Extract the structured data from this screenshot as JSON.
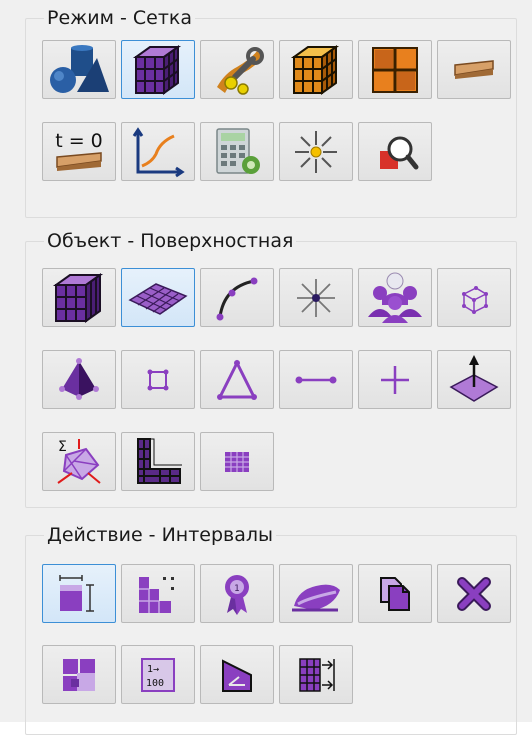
{
  "groups": {
    "mode": {
      "title": "Режим - Сетка",
      "buttons": [
        {
          "icon": "geometry-shapes-icon",
          "active": false
        },
        {
          "icon": "mesh-cube-icon",
          "active": true
        },
        {
          "icon": "tools-wrench-icon",
          "active": false
        },
        {
          "icon": "orange-mesh-cube-icon",
          "active": false
        },
        {
          "icon": "grid-frame-icon",
          "active": false
        },
        {
          "icon": "beam-bar-icon",
          "active": false
        },
        {
          "icon": "time-zero-icon",
          "label": "t = 0",
          "active": false
        },
        {
          "icon": "graph-curve-icon",
          "active": false
        },
        {
          "icon": "calculator-gear-icon",
          "active": false
        },
        {
          "icon": "sun-burst-icon",
          "active": false
        },
        {
          "icon": "zoom-inspect-icon",
          "active": false
        }
      ]
    },
    "object": {
      "title": "Объект - Поверхностная",
      "buttons": [
        {
          "icon": "volume-mesh-icon",
          "active": false
        },
        {
          "icon": "surface-mesh-icon",
          "active": true
        },
        {
          "icon": "curve-edge-icon",
          "active": false
        },
        {
          "icon": "node-star-icon",
          "active": false
        },
        {
          "icon": "group-people-icon",
          "active": false
        },
        {
          "icon": "small-cube-icon",
          "active": false
        },
        {
          "icon": "tetrahedron-icon",
          "active": false
        },
        {
          "icon": "quad-element-icon",
          "active": false
        },
        {
          "icon": "triangle-element-icon",
          "active": false
        },
        {
          "icon": "line-element-icon",
          "active": false
        },
        {
          "icon": "point-cross-icon",
          "active": false
        },
        {
          "icon": "normal-arrow-icon",
          "active": false
        },
        {
          "icon": "sum-quality-icon",
          "active": false
        },
        {
          "icon": "corner-mesh-icon",
          "active": false
        },
        {
          "icon": "small-grid-icon",
          "active": false
        }
      ]
    },
    "action": {
      "title": "Действие - Интервалы",
      "buttons": [
        {
          "icon": "interval-size-icon",
          "active": true
        },
        {
          "icon": "stair-grid-icon",
          "active": false
        },
        {
          "icon": "award-badge-icon",
          "active": false
        },
        {
          "icon": "iron-smooth-icon",
          "active": false
        },
        {
          "icon": "copy-pages-icon",
          "active": false
        },
        {
          "icon": "delete-x-icon",
          "active": false
        },
        {
          "icon": "split-block-icon",
          "active": false
        },
        {
          "icon": "number-range-icon",
          "label": "1→ 100",
          "active": false
        },
        {
          "icon": "angle-wedge-icon",
          "active": false
        },
        {
          "icon": "grid-arrows-icon",
          "active": false
        }
      ]
    }
  },
  "colors": {
    "accent_border": "#3c8fd6",
    "mesh_purple": "#8a3fc0",
    "mesh_dark": "#2a1a3a",
    "orange": "#e08a1a"
  }
}
